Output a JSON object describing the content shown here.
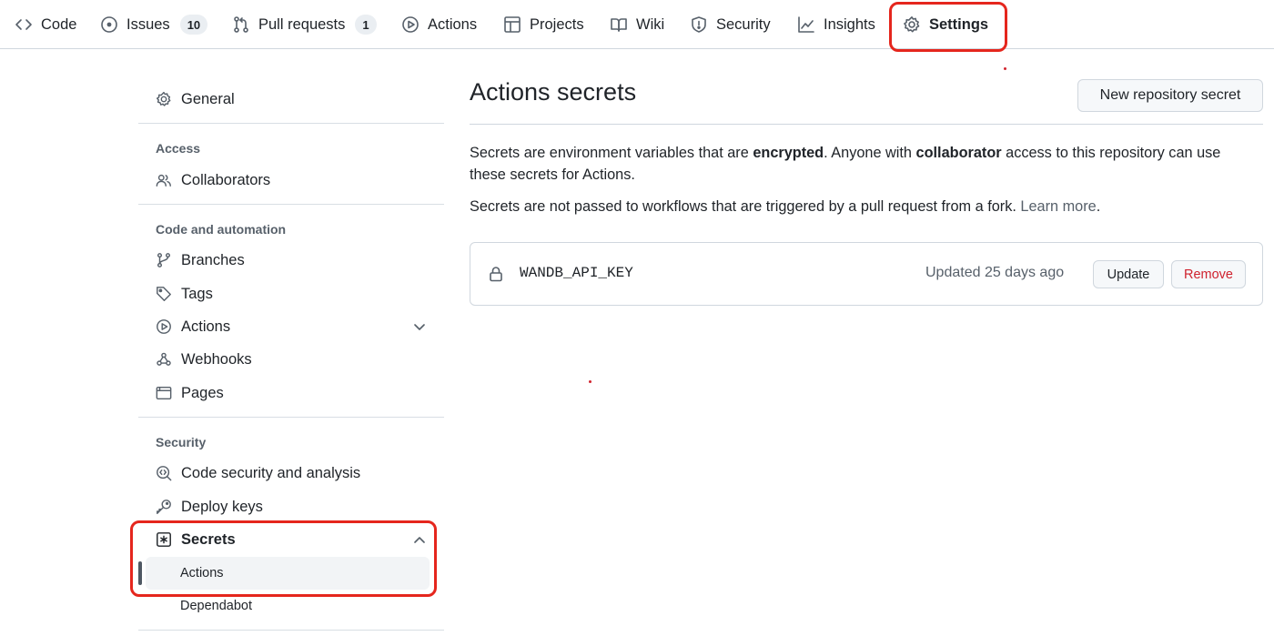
{
  "tabs": [
    {
      "label": "Code",
      "icon": "code-icon"
    },
    {
      "label": "Issues",
      "icon": "issue-opened-icon",
      "count": "10"
    },
    {
      "label": "Pull requests",
      "icon": "git-pull-request-icon",
      "count": "1"
    },
    {
      "label": "Actions",
      "icon": "play-icon"
    },
    {
      "label": "Projects",
      "icon": "table-icon"
    },
    {
      "label": "Wiki",
      "icon": "book-icon"
    },
    {
      "label": "Security",
      "icon": "shield-icon"
    },
    {
      "label": "Insights",
      "icon": "graph-icon"
    },
    {
      "label": "Settings",
      "icon": "gear-icon",
      "selected": true
    }
  ],
  "sidebar": {
    "general": "General",
    "access_heading": "Access",
    "collaborators": "Collaborators",
    "code_heading": "Code and automation",
    "branches": "Branches",
    "tags": "Tags",
    "actions": "Actions",
    "webhooks": "Webhooks",
    "pages": "Pages",
    "security_heading": "Security",
    "code_security": "Code security and analysis",
    "deploy_keys": "Deploy keys",
    "secrets": "Secrets",
    "secrets_actions": "Actions",
    "secrets_dependabot": "Dependabot"
  },
  "main": {
    "title": "Actions secrets",
    "new_secret_button": "New repository secret",
    "desc1_a": "Secrets are environment variables that are ",
    "desc1_b": "encrypted",
    "desc1_c": ". Anyone with ",
    "desc1_d": "collaborator",
    "desc1_e": " access to this repository can use these secrets for Actions.",
    "desc2_a": "Secrets are not passed to workflows that are triggered by a pull request from a fork. ",
    "desc2_link": "Learn more",
    "desc2_end": ".",
    "secrets": [
      {
        "name": "WANDB_API_KEY",
        "updated": "Updated 25 days ago",
        "update_label": "Update",
        "remove_label": "Remove"
      }
    ]
  },
  "colors": {
    "annotation_highlight": "#e5261d",
    "danger": "#cf222e",
    "muted": "#57606a"
  }
}
